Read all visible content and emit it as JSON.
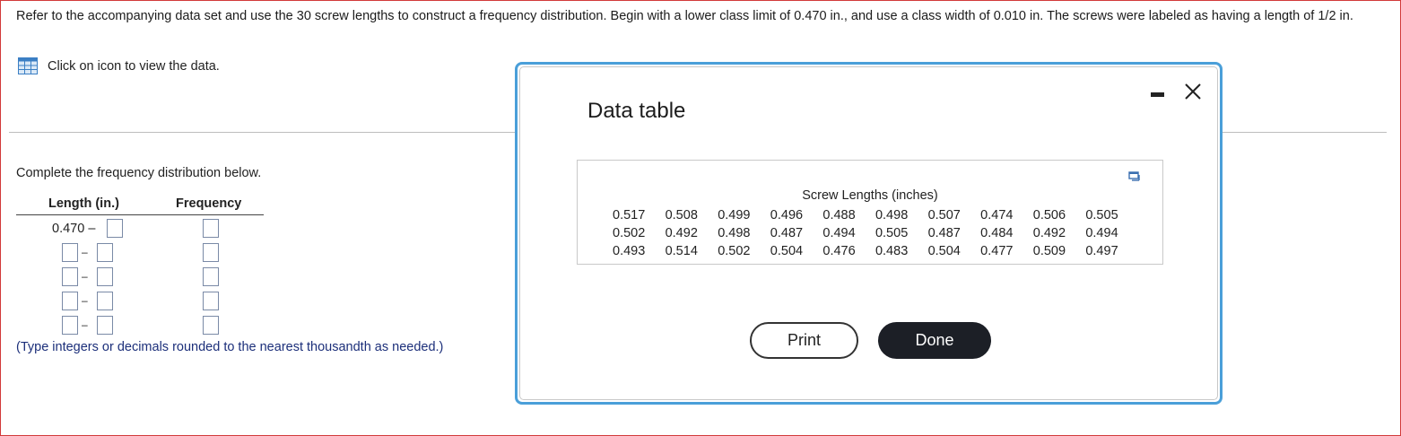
{
  "problem_text": "Refer to the accompanying data set and use the 30 screw lengths to construct a frequency distribution. Begin with a lower class limit of 0.470 in., and use a class width of 0.010 in. The screws were labeled as having a length of 1/2 in.",
  "view_data_label": "Click on icon to view the data.",
  "instruction": "Complete the frequency distribution below.",
  "table": {
    "col_length": "Length (in.)",
    "col_frequency": "Frequency",
    "first_lower": "0.470",
    "dash": "–"
  },
  "note": "(Type integers or decimals rounded to the nearest thousandth as needed.)",
  "modal": {
    "title": "Data table",
    "caption": "Screw Lengths (inches)",
    "rows": [
      [
        "0.517",
        "0.508",
        "0.499",
        "0.496",
        "0.488",
        "0.498",
        "0.507",
        "0.474",
        "0.506",
        "0.505"
      ],
      [
        "0.502",
        "0.492",
        "0.498",
        "0.487",
        "0.494",
        "0.505",
        "0.487",
        "0.484",
        "0.492",
        "0.494"
      ],
      [
        "0.493",
        "0.514",
        "0.502",
        "0.504",
        "0.476",
        "0.483",
        "0.504",
        "0.477",
        "0.509",
        "0.497"
      ]
    ],
    "print_label": "Print",
    "done_label": "Done"
  },
  "colors": {
    "modal_border": "#4a9fd9",
    "done_bg": "#1c1f26",
    "note_text": "#1c2f7a",
    "frame_border": "#d23a3a"
  }
}
